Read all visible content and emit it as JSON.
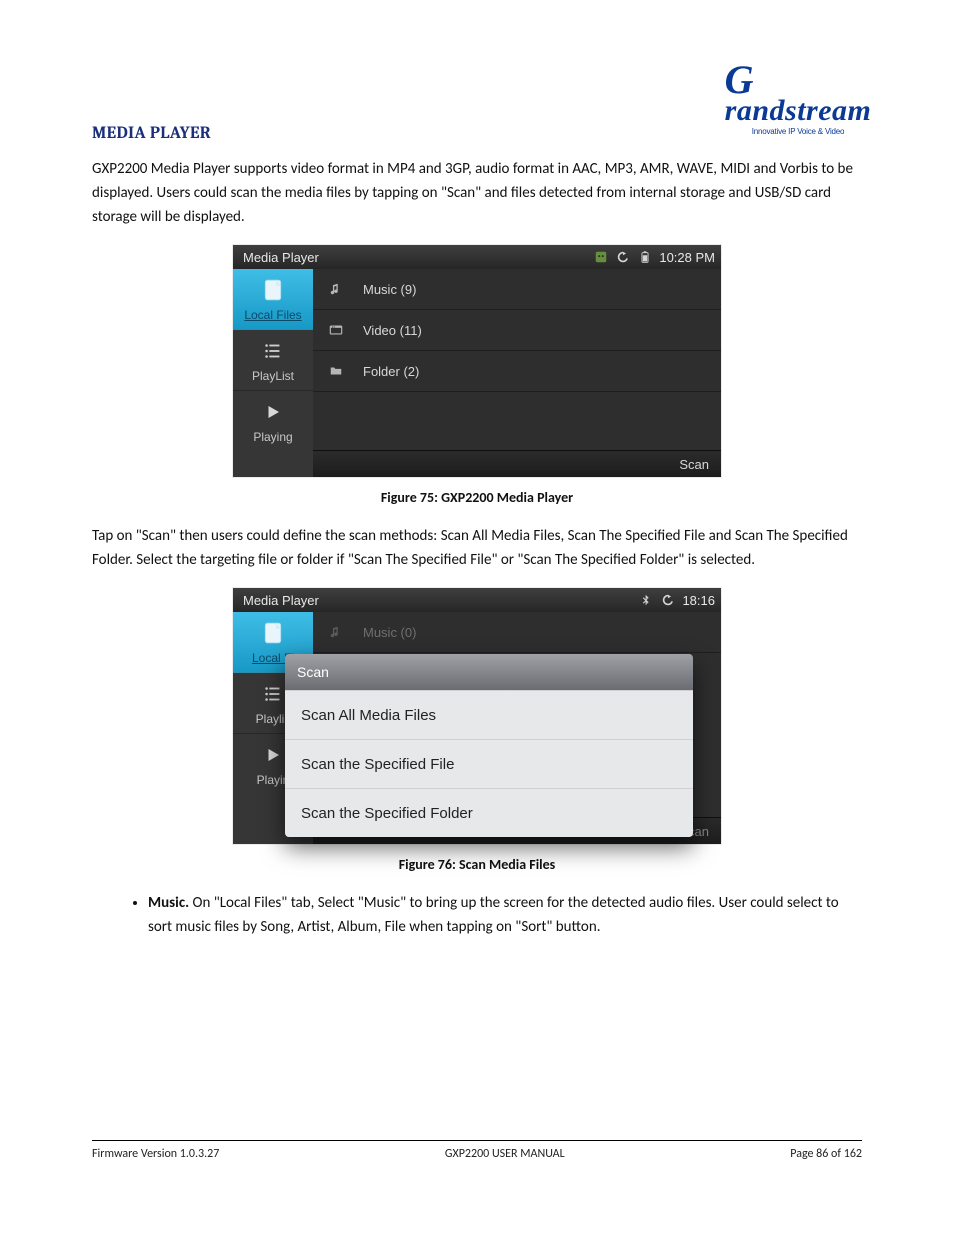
{
  "logo": {
    "brand_text": "Grandstream",
    "tagline": "Innovative IP Voice & Video"
  },
  "heading": "MEDIA PLAYER",
  "para1": "GXP2200 Media Player supports video format in MP4 and 3GP, audio format in AAC, MP3, AMR, WAVE, MIDI and Vorbis to be displayed. Users could scan the media files by tapping on \"Scan\" and files detected from internal storage and USB/SD card storage will be displayed.",
  "shot1": {
    "title": "Media Player",
    "time": "10:28 PM",
    "sidebar": [
      {
        "label": "Local Files"
      },
      {
        "label": "PlayList"
      },
      {
        "label": "Playing"
      }
    ],
    "rows": [
      {
        "label": "Music  (9)"
      },
      {
        "label": "Video  (11)"
      },
      {
        "label": "Folder  (2)"
      }
    ],
    "scan_label": "Scan"
  },
  "cap1": "Figure 75: GXP2200 Media Player",
  "para2": "Tap on \"Scan\" then users could define the scan methods: Scan All Media Files, Scan The Specified File and Scan The Specified Folder. Select the targeting file or folder if \"Scan The Specified File\" or \"Scan The Specified Folder\" is selected.",
  "shot2": {
    "title": "Media Player",
    "time": "18:16",
    "sidebar": [
      {
        "label": "Local Fi"
      },
      {
        "label": "Playlis"
      },
      {
        "label": "Playin"
      }
    ],
    "row_label": "Music   (0)",
    "scan_label": "Scan",
    "popup": {
      "title": "Scan",
      "items": [
        "Scan All Media Files",
        "Scan the Specified File",
        "Scan the Specified Folder"
      ]
    }
  },
  "cap2": "Figure 76: Scan Media Files",
  "bullet1_prefix": "Music.",
  "bullet1_rest": " On \"Local Files\" tab, Select \"Music\" to bring up the screen for the detected audio files. User could select to sort music files by Song, Artist, Album, File when tapping on \"Sort\" button.",
  "footer": {
    "left": "Firmware Version 1.0.3.27",
    "center": "GXP2200 USER MANUAL",
    "right": "Page 86 of 162"
  }
}
